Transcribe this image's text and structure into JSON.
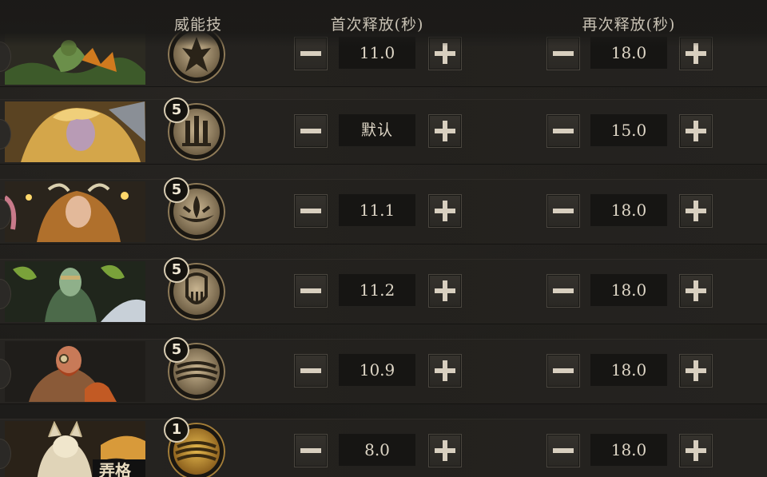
{
  "header": {
    "skill_col": "威能技",
    "first_col": "首次释放(秒)",
    "again_col": "再次释放(秒)"
  },
  "rows": [
    {
      "badge": "",
      "first": "11.0",
      "again": "18.0",
      "skill_icon": "rune-figure-icon",
      "portrait": "hero-portrait"
    },
    {
      "badge": "5",
      "first": "默认",
      "again": "15.0",
      "skill_icon": "rune-pillars-icon",
      "portrait": "hero-portrait"
    },
    {
      "badge": "5",
      "first": "11.1",
      "again": "18.0",
      "skill_icon": "rune-sprout-icon",
      "portrait": "hero-portrait"
    },
    {
      "badge": "5",
      "first": "11.2",
      "again": "18.0",
      "skill_icon": "rune-mask-icon",
      "portrait": "hero-portrait"
    },
    {
      "badge": "5",
      "first": "10.9",
      "again": "18.0",
      "skill_icon": "rune-shell-icon",
      "portrait": "hero-portrait"
    },
    {
      "badge": "1",
      "first": "8.0",
      "again": "18.0",
      "skill_icon": "rune-shell-gold-icon",
      "portrait": "hero-portrait",
      "partial_label": "弄格"
    }
  ],
  "buttons": {
    "minus_icon": "minus-icon",
    "plus_icon": "plus-icon"
  },
  "colors": {
    "accent_gold": "#c9a46a",
    "panel": "#23211e",
    "text": "#ded6c6"
  }
}
